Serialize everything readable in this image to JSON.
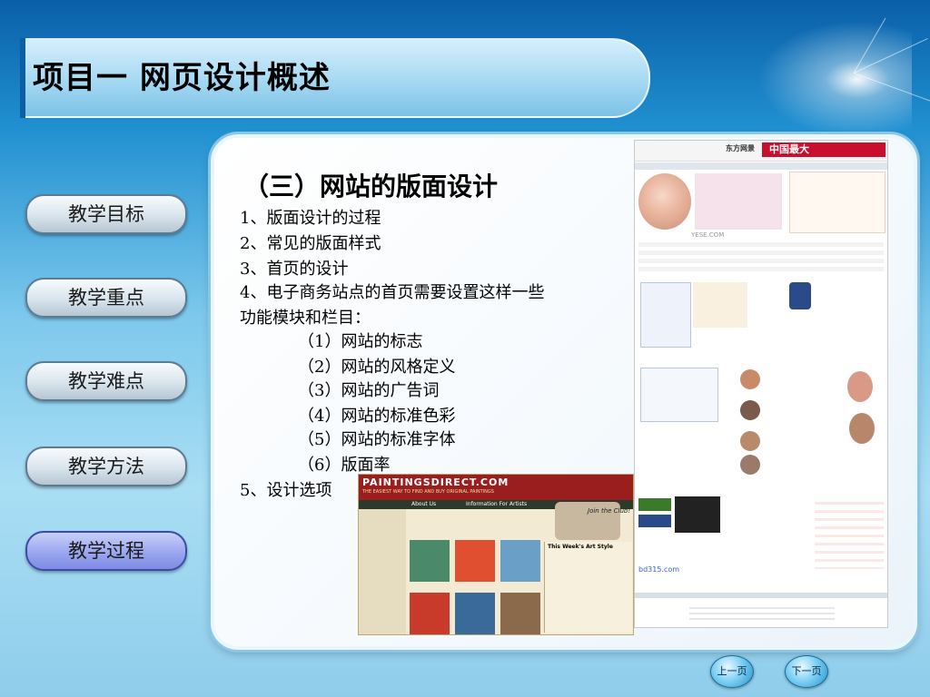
{
  "slide": {
    "title": "项目一 网页设计概述",
    "heading": "（三）网站的版面设计",
    "lines": [
      "1、版面设计的过程",
      "2、常见的版面样式",
      "3、首页的设计",
      "4、电子商务站点的首页需要设置这样一些",
      "功能模块和栏目：",
      "（1）网站的标志",
      "（2）网站的风格定义",
      "（3）网站的广告词",
      "（4）网站的标准色彩",
      "（5）网站的标准字体",
      "（6）版面率",
      "5、设计选项"
    ]
  },
  "nav": {
    "items": [
      "教学目标",
      "教学重点",
      "教学难点",
      "教学方法",
      "教学过程"
    ],
    "active_index": 4
  },
  "pager": {
    "prev": "上一页",
    "next": "下一页"
  },
  "screenshots": {
    "right": {
      "banner_text": "中国最大",
      "brand": "东方网景",
      "url_text": "YESE.COM",
      "footer_url": "bd315.com"
    },
    "left": {
      "logo_text": "PAINTINGSDIRECT.COM",
      "tagline": "THE EASIEST WAY TO FIND AND BUY ORIGINAL PAINTINGS",
      "menu_about": "About Us",
      "menu_info": "Information For Artists",
      "join_text": "Join the Club!",
      "section_title": "This Week's Art Style"
    }
  },
  "colors": {
    "accent": "#0d5ea3",
    "active_nav": "#8f9bea",
    "panel_border": "#8cc6e6"
  }
}
